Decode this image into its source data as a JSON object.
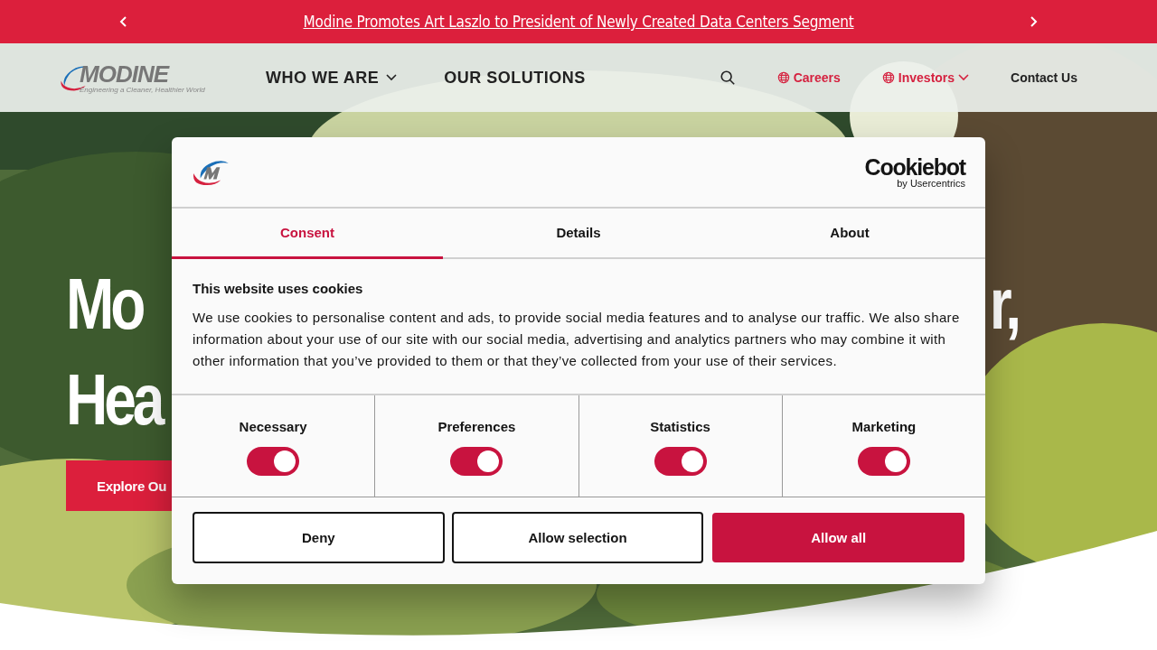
{
  "announcement": {
    "text": "Modine Promotes Art Laszlo to President of Newly Created Data Centers Segment"
  },
  "header": {
    "logo": {
      "name": "MODINE",
      "tagline": "Engineering a Cleaner, Healthier World"
    },
    "nav": [
      {
        "label": "WHO WE ARE",
        "has_menu": true
      },
      {
        "label": "OUR SOLUTIONS",
        "has_menu": false
      }
    ],
    "utility": [
      {
        "label": "Careers",
        "globe": true,
        "has_menu": false,
        "accent": true
      },
      {
        "label": "Investors",
        "globe": true,
        "has_menu": true,
        "accent": true
      },
      {
        "label": "Contact Us",
        "globe": false,
        "has_menu": false,
        "accent": false
      }
    ]
  },
  "hero": {
    "heading_lines": [
      {
        "left": "Mo",
        "right": "r,"
      },
      {
        "left": "Hea"
      }
    ],
    "button": "Explore Ou"
  },
  "cookie_dialog": {
    "brand": {
      "name": "Cookiebot",
      "byline": "by Usercentrics"
    },
    "tabs": [
      {
        "label": "Consent",
        "selected": true
      },
      {
        "label": "Details",
        "selected": false
      },
      {
        "label": "About",
        "selected": false
      }
    ],
    "title": "This website uses cookies",
    "body": "We use cookies to personalise content and ads, to provide social media features and to analyse our traffic. We also share information about your use of our site with our social media, advertising and analytics partners who may combine it with other information that you’ve provided to them or that they’ve collected from your use of their services.",
    "categories": [
      {
        "label": "Necessary",
        "checked": true
      },
      {
        "label": "Preferences",
        "checked": true
      },
      {
        "label": "Statistics",
        "checked": true
      },
      {
        "label": "Marketing",
        "checked": true
      }
    ],
    "buttons": [
      {
        "label": "Deny",
        "kind": "outline"
      },
      {
        "label": "Allow selection",
        "kind": "outline"
      },
      {
        "label": "Allow all",
        "kind": "primary"
      }
    ]
  }
}
